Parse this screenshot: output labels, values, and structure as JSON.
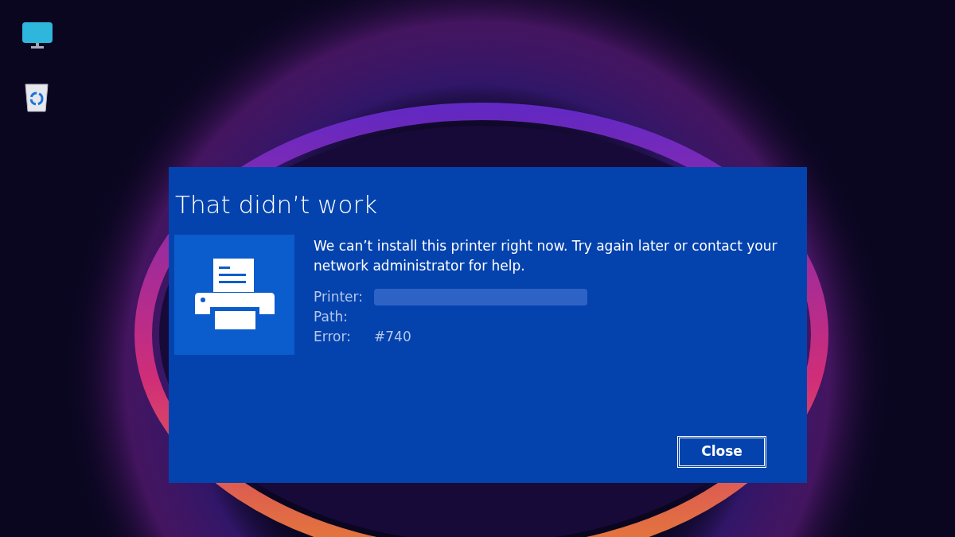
{
  "dialog": {
    "title": "That didn’t work",
    "message": "We can’t install this printer right now. Try again later or contact your network administrator for help.",
    "details": [
      {
        "label": "Printer:",
        "kind": "redacted"
      },
      {
        "label": "Path:",
        "kind": "empty"
      },
      {
        "label": "Error:",
        "kind": "text",
        "value": "#740"
      }
    ],
    "button": "Close"
  }
}
